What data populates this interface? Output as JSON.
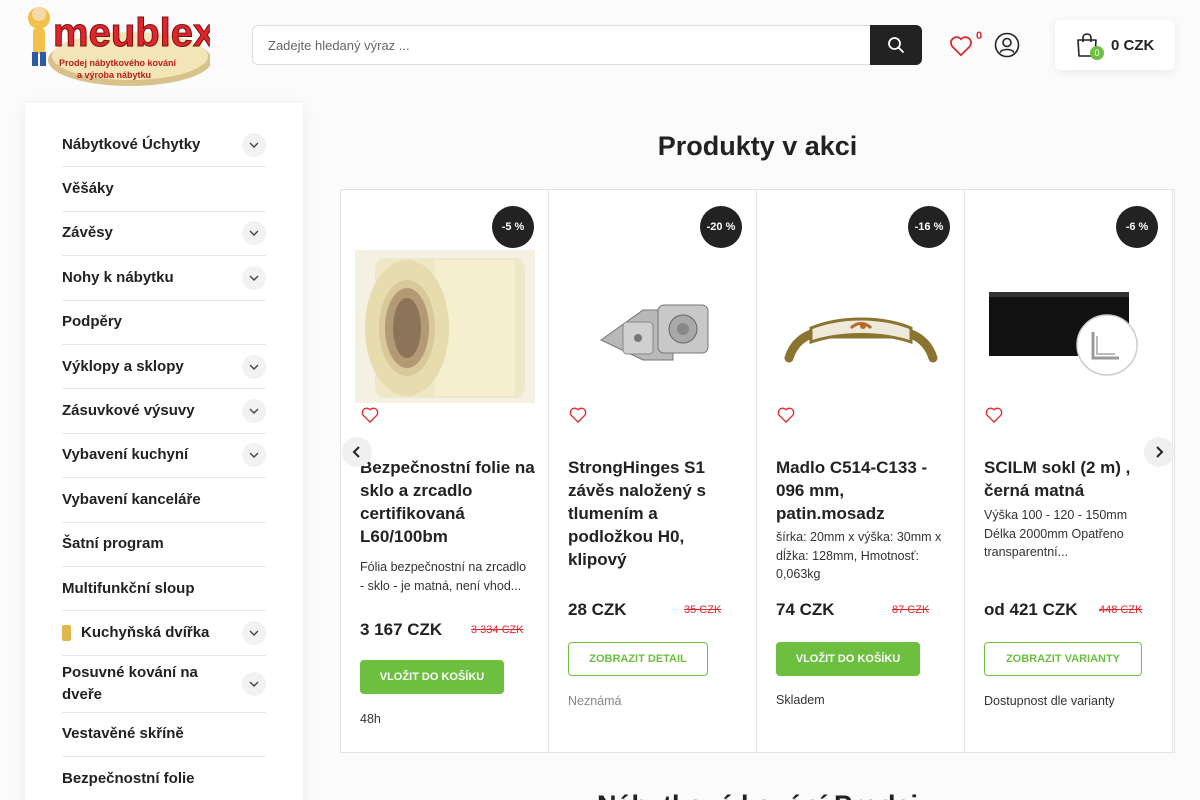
{
  "header": {
    "logo_text": "meublex",
    "logo_tagline": "Prodej nábytkového kování a výroba nábytku",
    "search_placeholder": "Zadejte hledaný výraz ...",
    "wishlist_count": "0",
    "cart_count": "0",
    "cart_total": "0 CZK"
  },
  "sidebar": {
    "items": [
      {
        "label": "Nábytkové Úchytky",
        "expandable": true
      },
      {
        "label": "Věšáky",
        "expandable": false
      },
      {
        "label": "Závěsy",
        "expandable": true
      },
      {
        "label": "Nohy k nábytku",
        "expandable": true
      },
      {
        "label": "Podpěry",
        "expandable": false
      },
      {
        "label": "Výklopy a sklopy",
        "expandable": true
      },
      {
        "label": "Zásuvkové výsuvy",
        "expandable": true
      },
      {
        "label": "Vybavení kuchyní",
        "expandable": true
      },
      {
        "label": "Vybavení kanceláře",
        "expandable": false
      },
      {
        "label": "Šatní program",
        "expandable": false
      },
      {
        "label": "Multifunkční sloup",
        "expandable": false
      },
      {
        "label": "Kuchyňská dvířka",
        "expandable": true,
        "marked": true
      },
      {
        "label": "Posuvné kování na dveře",
        "expandable": true
      },
      {
        "label": "Vestavěné skříně",
        "expandable": false
      },
      {
        "label": "Bezpečnostní folie",
        "expandable": false
      }
    ]
  },
  "main": {
    "section_title": "Produkty v akci",
    "next_section_title": "Nábytkové kování Prodej",
    "products": [
      {
        "discount": "-5 %",
        "name": "Bezpečnostní folie na sklo a zrcadlo certifikovaná L60/100bm",
        "description": "Fólia bezpečnostní na zrcadlo - sklo - je matná, není vhod...",
        "price": "3 167 CZK",
        "old_price": "3 334 CZK",
        "button": "VLOŽIT DO KOŠÍKU",
        "button_style": "filled",
        "availability": "48h"
      },
      {
        "discount": "-20 %",
        "name": "StrongHinges S1 závěs naložený s tlumením a podložkou H0, klipový",
        "description": "",
        "price": "28 CZK",
        "old_price": "35 CZK",
        "button": "ZOBRAZIT DETAIL",
        "button_style": "outline",
        "availability": "Neznámá"
      },
      {
        "discount": "-16 %",
        "name": "Madlo C514-C133 - 096 mm, patin.mosadz",
        "description": "šírka: 20mm x výška: 30mm x dĺžka: 128mm, Hmotnosť: 0,063kg",
        "price": "74 CZK",
        "old_price": "87 CZK",
        "button": "VLOŽIT DO KOŠÍKU",
        "button_style": "filled",
        "availability": "Skladem"
      },
      {
        "discount": "-6 %",
        "name": "SCILM sokl (2 m) , černá matná",
        "description": "Výška 100 - 120 - 150mm Délka 2000mm Opatřeno transparentní...",
        "price": "od 421 CZK",
        "old_price": "448 CZK",
        "button": "ZOBRAZIT VARIANTY",
        "button_style": "outline",
        "availability": "Dostupnost dle varianty"
      }
    ]
  },
  "colors": {
    "accent_green": "#6cbf3f",
    "sale_red": "#e0262d",
    "badge_dark": "#222222"
  }
}
